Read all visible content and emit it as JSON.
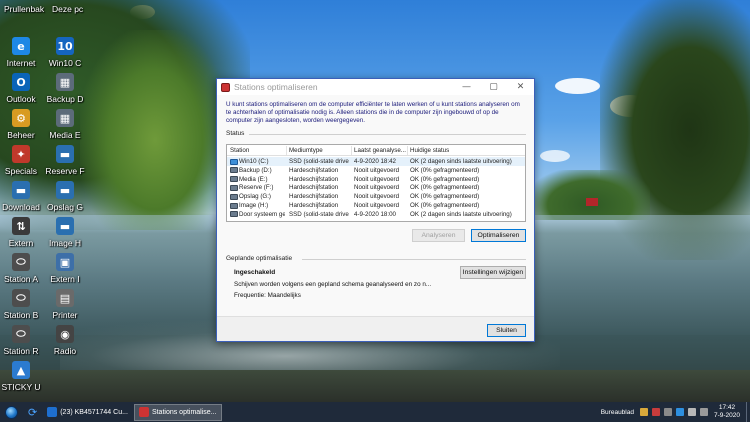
{
  "desktop": {
    "top_labels": [
      "Prullenbak",
      "Deze pc"
    ],
    "icons": [
      {
        "label": "Internet",
        "glyph": "e",
        "color": "#1e88e5",
        "icon": "internet-explorer-icon"
      },
      {
        "label": "Win10 C",
        "glyph": "10",
        "color": "#1565c0",
        "icon": "win10-drive-icon"
      },
      {
        "label": "Outlook",
        "glyph": "O",
        "color": "#0a64b8",
        "icon": "outlook-icon"
      },
      {
        "label": "Backup D",
        "glyph": "▦",
        "color": "#5c6b7a",
        "icon": "backup-drive-icon"
      },
      {
        "label": "Beheer",
        "glyph": "⚙",
        "color": "#d89b22",
        "icon": "beheer-icon"
      },
      {
        "label": "Media E",
        "glyph": "▦",
        "color": "#5c6b7a",
        "icon": "media-drive-icon"
      },
      {
        "label": "Specials",
        "glyph": "✦",
        "color": "#c0392b",
        "icon": "specials-icon"
      },
      {
        "label": "Reserve F",
        "glyph": "▬",
        "color": "#2a6fb0",
        "icon": "reserve-drive-icon"
      },
      {
        "label": "Download",
        "glyph": "▬",
        "color": "#2a6fb0",
        "icon": "download-drive-icon"
      },
      {
        "label": "Opslag G",
        "glyph": "▬",
        "color": "#2a6fb0",
        "icon": "opslag-drive-icon"
      },
      {
        "label": "Extern",
        "glyph": "⇅",
        "color": "#3a3a3a",
        "icon": "extern-drive-icon"
      },
      {
        "label": "Image H",
        "glyph": "▬",
        "color": "#2a6fb0",
        "icon": "image-drive-icon"
      },
      {
        "label": "Station A",
        "glyph": "⬭",
        "color": "#4d4d4d",
        "icon": "station-a-icon"
      },
      {
        "label": "Extern I",
        "glyph": "▣",
        "color": "#3d6fa8",
        "icon": "extern-i-icon"
      },
      {
        "label": "Station B",
        "glyph": "⬭",
        "color": "#4d4d4d",
        "icon": "station-b-icon"
      },
      {
        "label": "Printer",
        "glyph": "▤",
        "color": "#6a6a6a",
        "icon": "printer-icon"
      },
      {
        "label": "Station R",
        "glyph": "⬭",
        "color": "#4d4d4d",
        "icon": "station-r-icon"
      },
      {
        "label": "Radio",
        "glyph": "◉",
        "color": "#444444",
        "icon": "radio-icon"
      },
      {
        "label": "STICKY U",
        "glyph": "▲",
        "color": "#2b7bd0",
        "icon": "sticky-usb-icon"
      }
    ]
  },
  "dialog": {
    "title": "Stations optimaliseren",
    "intro": "U kunt stations optimaliseren om de computer efficiënter te laten werken of u kunt stations analyseren om te achterhalen of optimalisatie nodig is. Alleen stations die in de computer zijn ingebouwd of op de computer zijn aangesloten, worden weergegeven.",
    "status_label": "Status",
    "columns": [
      "Station",
      "Mediumtype",
      "Laatst geanalyse...",
      "Huidige status"
    ],
    "rows": [
      {
        "station": "Win10 (C:)",
        "media": "SSD (solid-state drive)",
        "last": "4-9-2020 18:42",
        "status": "OK (2 dagen sinds laatste uitvoering)",
        "selected": true
      },
      {
        "station": "Backup (D:)",
        "media": "Hardeschijfstation",
        "last": "Nooit uitgevoerd",
        "status": "OK (0% gefragmenteerd)"
      },
      {
        "station": "Media (E:)",
        "media": "Hardeschijfstation",
        "last": "Nooit uitgevoerd",
        "status": "OK (0% gefragmenteerd)"
      },
      {
        "station": "Reserve (F:)",
        "media": "Hardeschijfstation",
        "last": "Nooit uitgevoerd",
        "status": "OK (0% gefragmenteerd)"
      },
      {
        "station": "Opslag (G:)",
        "media": "Hardeschijfstation",
        "last": "Nooit uitgevoerd",
        "status": "OK (0% gefragmenteerd)"
      },
      {
        "station": "Image (H:)",
        "media": "Hardeschijfstation",
        "last": "Nooit uitgevoerd",
        "status": "OK (0% gefragmenteerd)"
      },
      {
        "station": "Door systeem ge...",
        "media": "SSD (solid-state drive)",
        "last": "4-9-2020 18:00",
        "status": "OK (2 dagen sinds laatste uitvoering)"
      }
    ],
    "analyze_label": "Analyseren",
    "optimize_label": "Optimaliseren",
    "scheduled_label": "Geplande optimalisatie",
    "scheduled_state": "Ingeschakeld",
    "scheduled_desc": "Schijven worden volgens een gepland schema geanalyseerd en zo n...",
    "frequency": "Frequentie: Maandelijks",
    "settings_label": "Instellingen wijzigen",
    "close_label": "Sluiten"
  },
  "taskbar": {
    "apps": [
      {
        "label": "(23) KB4571744 Cu...",
        "active": false
      },
      {
        "label": "Stations optimalise...",
        "active": true
      }
    ],
    "tray_text": "Bureaublad",
    "time": "17:42",
    "date": "7-9-2020"
  }
}
